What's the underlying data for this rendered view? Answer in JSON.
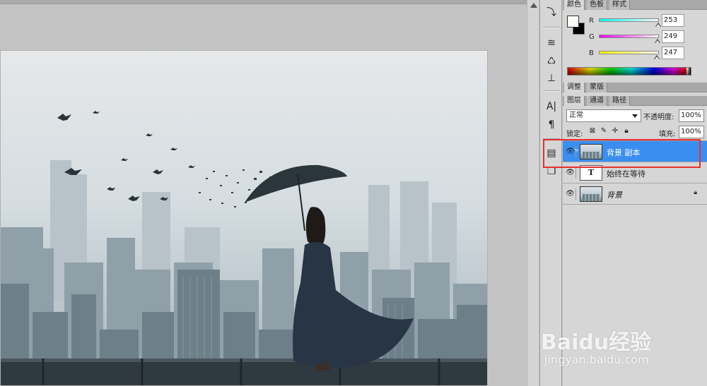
{
  "color_panel": {
    "tabs": [
      "颜色",
      "色板",
      "样式"
    ],
    "channels": [
      {
        "label": "R",
        "value": "253",
        "level": 0.99
      },
      {
        "label": "G",
        "value": "249",
        "level": 0.98
      },
      {
        "label": "B",
        "value": "247",
        "level": 0.97
      }
    ],
    "foreground": "#fdf9f7",
    "background": "#000000"
  },
  "adjust_tabs": [
    "调整",
    "蒙版"
  ],
  "layers_panel": {
    "tabs": [
      "图层",
      "通道",
      "路径"
    ],
    "blend_mode": "正常",
    "opacity_label": "不透明度:",
    "opacity_value": "100%",
    "lock_label": "锁定:",
    "fill_label": "填充:",
    "fill_value": "100%",
    "layers": [
      {
        "name": "背景 副本",
        "type": "image",
        "selected": true
      },
      {
        "name": "始终在等待",
        "type": "text",
        "thumb_label": "T",
        "selected": false
      },
      {
        "name": "背景",
        "type": "image",
        "selected": false
      }
    ]
  },
  "watermark": {
    "logo": "Baidu经验",
    "url": "jingyan.baidu.com"
  },
  "accent_colors": {
    "selection": "#3a8ef0",
    "annotation": "#e83030"
  }
}
